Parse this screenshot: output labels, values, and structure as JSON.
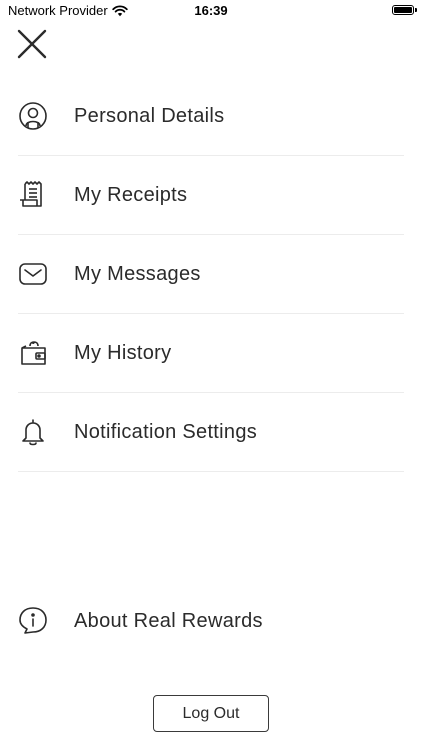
{
  "status_bar": {
    "carrier": "Network Provider",
    "time": "16:39"
  },
  "menu": {
    "items": [
      {
        "label": "Personal Details",
        "icon": "person-icon"
      },
      {
        "label": "My Receipts",
        "icon": "receipt-icon"
      },
      {
        "label": "My Messages",
        "icon": "mail-icon"
      },
      {
        "label": "My History",
        "icon": "wallet-icon"
      },
      {
        "label": "Notification Settings",
        "icon": "bell-icon"
      }
    ]
  },
  "about": {
    "label": "About Real Rewards",
    "icon": "info-icon"
  },
  "logout_label": "Log Out",
  "colors": {
    "text": "#2b2b2b",
    "divider": "#ececec",
    "background": "#ffffff"
  }
}
